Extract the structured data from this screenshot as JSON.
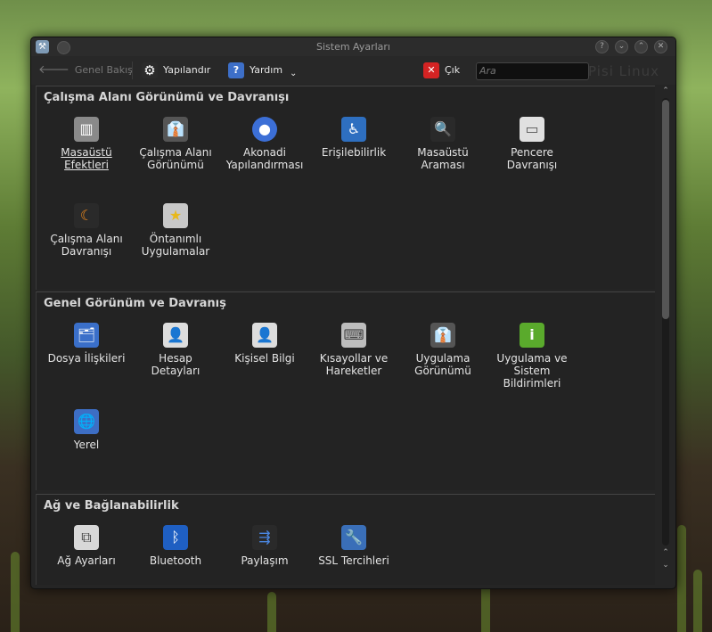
{
  "window": {
    "title": "Sistem Ayarları"
  },
  "toolbar": {
    "back_label": "Genel Bakış",
    "configure_label": "Yapılandır",
    "help_label": "Yardım",
    "help_arrow": "⌄",
    "quit_label": "Çık",
    "search_placeholder": "Ara",
    "watermark": "Pisi Linux"
  },
  "sections": [
    {
      "title": "Çalışma Alanı Görünümü ve Davranışı",
      "items": [
        {
          "label": "Masaüstü\nEfektleri",
          "icon": "desktop-effects-icon",
          "color": "#8a8a8a",
          "glyph": "▥"
        },
        {
          "label": "Çalışma Alanı\nGörünümü",
          "icon": "workspace-appearance-icon",
          "color": "#555555",
          "glyph": "👔"
        },
        {
          "label": "Akonadi\nYapılandırması",
          "icon": "akonadi-icon",
          "color": "#3c6fd6",
          "glyph": "●"
        },
        {
          "label": "Erişilebilirlik",
          "icon": "accessibility-icon",
          "color": "#2e6fc0",
          "glyph": "♿"
        },
        {
          "label": "Masaüstü\nAraması",
          "icon": "desktop-search-icon",
          "color": "#2a2a2a",
          "glyph": "🔍"
        },
        {
          "label": "Pencere\nDavranışı",
          "icon": "window-behavior-icon",
          "color": "#e0e0e0",
          "glyph": "▭"
        },
        {
          "label": "Çalışma Alanı\nDavranışı",
          "icon": "workspace-behavior-icon",
          "color": "#2a2a2a",
          "glyph": "☾"
        },
        {
          "label": "Öntanımlı\nUygulamalar",
          "icon": "default-applications-icon",
          "color": "#c8c8c8",
          "glyph": "★"
        }
      ]
    },
    {
      "title": "Genel Görünüm ve Davranış",
      "items": [
        {
          "label": "Dosya İlişkileri",
          "icon": "file-associations-icon",
          "color": "#3a6fc9",
          "glyph": "🗂"
        },
        {
          "label": "Hesap\nDetayları",
          "icon": "account-details-icon",
          "color": "#dddddd",
          "glyph": "👤"
        },
        {
          "label": "Kişisel Bilgi",
          "icon": "personal-info-icon",
          "color": "#dddddd",
          "glyph": "👤"
        },
        {
          "label": "Kısayollar ve\nHareketler",
          "icon": "shortcuts-icon",
          "color": "#bdbdbd",
          "glyph": "⌨"
        },
        {
          "label": "Uygulama\nGörünümü",
          "icon": "application-appearance-icon",
          "color": "#555555",
          "glyph": "👔"
        },
        {
          "label": "Uygulama ve\nSistem\nBildirimleri",
          "icon": "notifications-icon",
          "color": "#5aaa2c",
          "glyph": "i"
        },
        {
          "label": "Yerel",
          "icon": "locale-icon",
          "color": "#3d6ec4",
          "glyph": "🌐"
        }
      ]
    },
    {
      "title": "Ağ ve Bağlanabilirlik",
      "items": [
        {
          "label": "Ağ Ayarları",
          "icon": "network-settings-icon",
          "color": "#d8d8d8",
          "glyph": "⧉"
        },
        {
          "label": "Bluetooth",
          "icon": "bluetooth-icon",
          "color": "#1f5fc2",
          "glyph": "ᛒ"
        },
        {
          "label": "Paylaşım",
          "icon": "sharing-icon",
          "color": "#2a2a2a",
          "glyph": "⇶"
        },
        {
          "label": "SSL Tercihleri",
          "icon": "ssl-preferences-icon",
          "color": "#3a6fb8",
          "glyph": "🔧"
        }
      ]
    }
  ]
}
